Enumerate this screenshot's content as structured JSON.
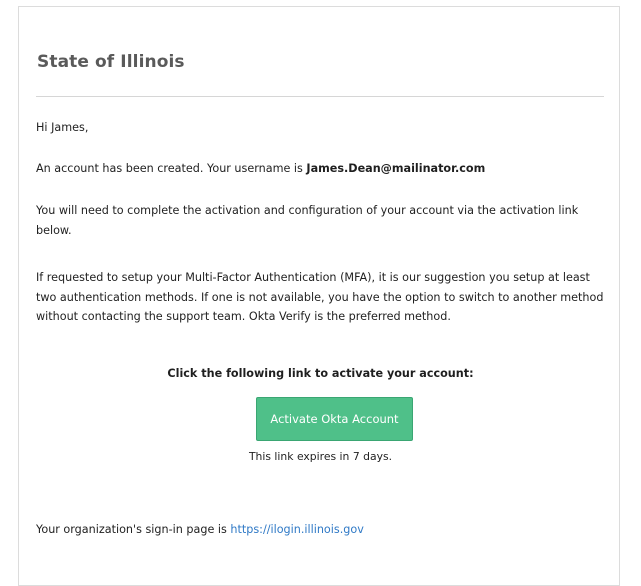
{
  "email": {
    "title": "State of Illinois",
    "greeting": "Hi James,",
    "account_created_text": "An account has been created. Your username is ",
    "username": "James.Dean@mailinator.com",
    "activation_text": "You will need to complete the activation and configuration of your account via the activation link below.",
    "mfa_text": "If requested to setup your Multi-Factor Authentication (MFA), it is our suggestion you setup at least two authentication methods. If one is not available, you have the option to switch to another method without contacting the support team. Okta Verify is the preferred method.",
    "cta_heading": "Click the following link to activate your account:",
    "cta_button_label": "Activate Okta Account",
    "expiry_text": "This link expires in 7 days.",
    "signin_text": "Your organization's sign-in page is ",
    "signin_url": "https://ilogin.illinois.gov"
  },
  "colors": {
    "button": "#4fc089",
    "link": "#2f79c6",
    "title": "#5a5a5a"
  }
}
